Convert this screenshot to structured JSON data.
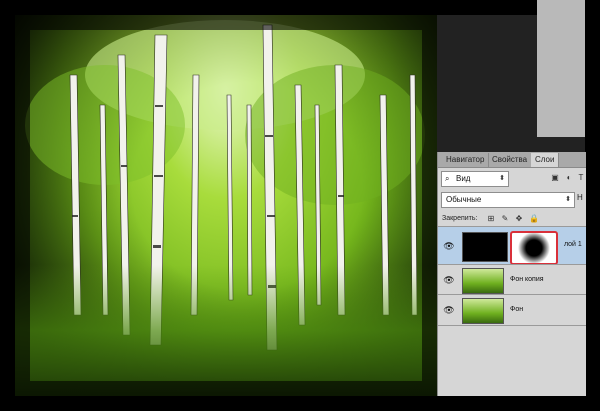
{
  "layers_panel": {
    "tabs": [
      {
        "label": "Навигатор"
      },
      {
        "label": "Свойства"
      },
      {
        "label": "Слои"
      }
    ],
    "filter": {
      "value": "Вид",
      "search_icon": "search-icon"
    },
    "blend_mode": {
      "value": "Обычные",
      "opacity_label_partial": "Н"
    },
    "lock_label": "Закрепить:",
    "layers": [
      {
        "name": "лой 1",
        "visible": true,
        "selected": true,
        "has_mask": true
      },
      {
        "name": "Фон копия",
        "visible": true,
        "selected": false,
        "has_mask": false
      },
      {
        "name": "Фон",
        "visible": true,
        "selected": false,
        "has_mask": false
      }
    ]
  },
  "colors": {
    "highlight_outline": "#d9303a",
    "active_layer_bg": "#b6cfe8",
    "panel_bg": "#d6d6d6"
  }
}
